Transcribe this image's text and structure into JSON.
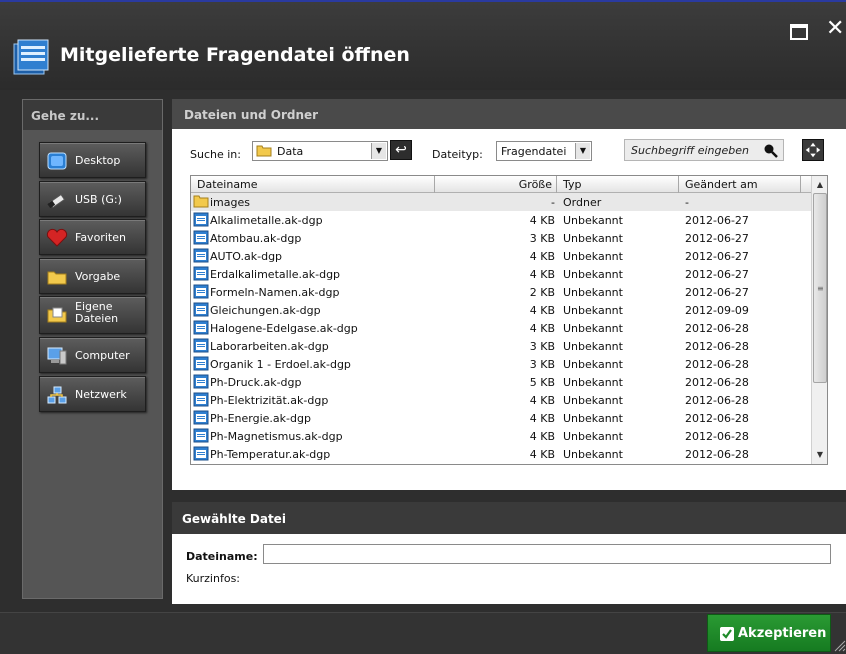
{
  "window": {
    "title": "Mitgelieferte Fragendatei öffnen",
    "icons": [
      "app-files-icon",
      "maximize-icon",
      "close-icon"
    ],
    "close_glyph": "✕"
  },
  "sidebar": {
    "heading": "Gehe zu...",
    "items": [
      {
        "label": "Desktop",
        "icon": "desktop-icon"
      },
      {
        "label": "USB (G:)",
        "icon": "usb-drive-icon"
      },
      {
        "label": "Favoriten",
        "icon": "heart-icon"
      },
      {
        "label": "Vorgabe",
        "icon": "folder-icon"
      },
      {
        "label": "Eigene Dateien",
        "icon": "documents-folder-icon"
      },
      {
        "label": "Computer",
        "icon": "computer-icon"
      },
      {
        "label": "Netzwerk",
        "icon": "network-icon"
      }
    ]
  },
  "files": {
    "heading": "Dateien und Ordner",
    "lookin_label": "Suche in:",
    "lookin_value": "Data",
    "filetype_label": "Dateityp:",
    "filetype_value": "Fragendatei",
    "search_placeholder": "Suchbegriff eingeben",
    "columns": {
      "name": "Dateiname",
      "size": "Größe",
      "type": "Typ",
      "date": "Geändert am"
    },
    "rows": [
      {
        "name": "images",
        "size": "-",
        "type": "Ordner",
        "date": "-",
        "icon": "folder-icon"
      },
      {
        "name": "Alkalimetalle.ak-dgp",
        "size": "4 KB",
        "type": "Unbekannt",
        "date": "2012-06-27",
        "icon": "file-icon"
      },
      {
        "name": "Atombau.ak-dgp",
        "size": "3 KB",
        "type": "Unbekannt",
        "date": "2012-06-27",
        "icon": "file-icon"
      },
      {
        "name": "AUTO.ak-dgp",
        "size": "4 KB",
        "type": "Unbekannt",
        "date": "2012-06-27",
        "icon": "file-icon"
      },
      {
        "name": "Erdalkalimetalle.ak-dgp",
        "size": "4 KB",
        "type": "Unbekannt",
        "date": "2012-06-27",
        "icon": "file-icon"
      },
      {
        "name": "Formeln-Namen.ak-dgp",
        "size": "2 KB",
        "type": "Unbekannt",
        "date": "2012-06-27",
        "icon": "file-icon"
      },
      {
        "name": "Gleichungen.ak-dgp",
        "size": "4 KB",
        "type": "Unbekannt",
        "date": "2012-09-09",
        "icon": "file-icon"
      },
      {
        "name": "Halogene-Edelgase.ak-dgp",
        "size": "4 KB",
        "type": "Unbekannt",
        "date": "2012-06-28",
        "icon": "file-icon"
      },
      {
        "name": "Laborarbeiten.ak-dgp",
        "size": "3 KB",
        "type": "Unbekannt",
        "date": "2012-06-28",
        "icon": "file-icon"
      },
      {
        "name": "Organik 1 - Erdoel.ak-dgp",
        "size": "3 KB",
        "type": "Unbekannt",
        "date": "2012-06-28",
        "icon": "file-icon"
      },
      {
        "name": "Ph-Druck.ak-dgp",
        "size": "5 KB",
        "type": "Unbekannt",
        "date": "2012-06-28",
        "icon": "file-icon"
      },
      {
        "name": "Ph-Elektrizität.ak-dgp",
        "size": "4 KB",
        "type": "Unbekannt",
        "date": "2012-06-28",
        "icon": "file-icon"
      },
      {
        "name": "Ph-Energie.ak-dgp",
        "size": "4 KB",
        "type": "Unbekannt",
        "date": "2012-06-28",
        "icon": "file-icon"
      },
      {
        "name": "Ph-Magnetismus.ak-dgp",
        "size": "4 KB",
        "type": "Unbekannt",
        "date": "2012-06-28",
        "icon": "file-icon"
      },
      {
        "name": "Ph-Temperatur.ak-dgp",
        "size": "4 KB",
        "type": "Unbekannt",
        "date": "2012-06-28",
        "icon": "file-icon"
      }
    ]
  },
  "selected": {
    "heading": "Gewählte Datei",
    "filename_label": "Dateiname:",
    "filename_value": "",
    "info_label": "Kurzinfos:"
  },
  "footer": {
    "accept_label": "Akzeptieren",
    "accept_color": "#1f8a2a"
  }
}
